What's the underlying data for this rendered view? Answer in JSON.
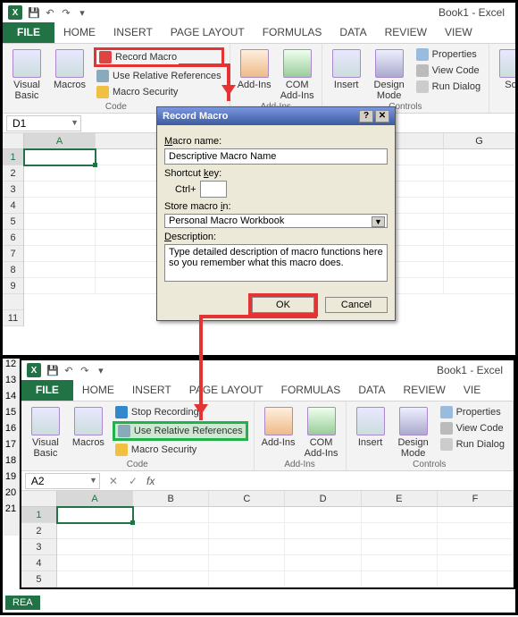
{
  "top": {
    "qat_title": "Book1 - Excel",
    "tabs": [
      "FILE",
      "HOME",
      "INSERT",
      "PAGE LAYOUT",
      "FORMULAS",
      "DATA",
      "REVIEW",
      "VIEW"
    ],
    "code_group": {
      "visual_basic": "Visual\nBasic",
      "macros": "Macros",
      "record_macro": "Record Macro",
      "use_relative": "Use Relative References",
      "macro_security": "Macro Security",
      "label": "Code"
    },
    "addins_group": {
      "addins": "Add-Ins",
      "com": "COM\nAdd-Ins",
      "label": "Add-Ins"
    },
    "controls_group": {
      "insert": "Insert",
      "design": "Design\nMode",
      "properties": "Properties",
      "view_code": "View Code",
      "run_dialog": "Run Dialog",
      "label": "Controls"
    },
    "source": "Sou",
    "namebox": "D1",
    "columns": [
      "A",
      "G"
    ],
    "rows": [
      "1",
      "2",
      "3",
      "4",
      "5",
      "6",
      "7",
      "8",
      "9",
      "",
      "11"
    ]
  },
  "dialog": {
    "title": "Record Macro",
    "macro_name_label": "Macro name:",
    "macro_name_value": "Descriptive Macro Name",
    "shortcut_label": "Shortcut key:",
    "shortcut_prefix": "Ctrl+",
    "store_label": "Store macro in:",
    "store_value": "Personal Macro Workbook",
    "description_label": "Description:",
    "description_value": "Type detailed description of macro functions here so you remember what this macro does.",
    "ok": "OK",
    "cancel": "Cancel"
  },
  "bottom": {
    "qat_title": "Book1 - Excel",
    "tabs": [
      "FILE",
      "HOME",
      "INSERT",
      "PAGE LAYOUT",
      "FORMULAS",
      "DATA",
      "REVIEW",
      "VIE"
    ],
    "code_group": {
      "visual_basic": "Visual\nBasic",
      "macros": "Macros",
      "stop_recording": "Stop Recording",
      "use_relative": "Use Relative References",
      "macro_security": "Macro Security",
      "label": "Code"
    },
    "addins_group": {
      "addins": "Add-Ins",
      "com": "COM\nAdd-Ins",
      "label": "Add-Ins"
    },
    "controls_group": {
      "insert": "Insert",
      "design": "Design\nMode",
      "properties": "Properties",
      "view_code": "View Code",
      "run_dialog": "Run Dialog",
      "label": "Controls"
    },
    "namebox": "A2",
    "fx_label": "fx",
    "columns": [
      "A",
      "B",
      "C",
      "D",
      "E",
      "F"
    ],
    "rows": [
      "1",
      "2",
      "3",
      "4",
      "5"
    ],
    "sheet_tab": "REA"
  },
  "chart_data": null
}
